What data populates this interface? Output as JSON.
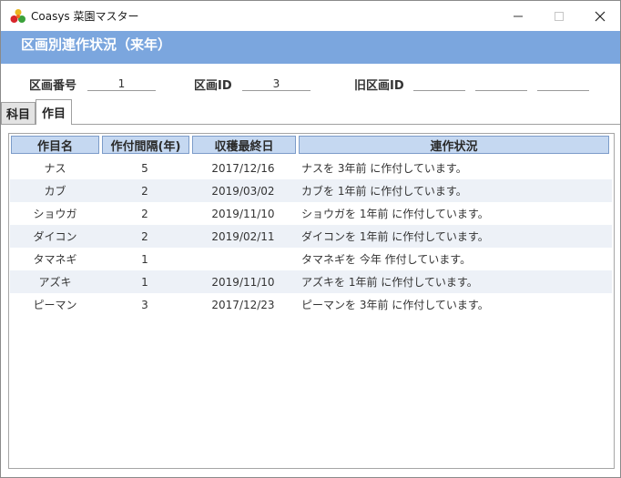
{
  "window": {
    "title": "Coasys 菜園マスター"
  },
  "header": {
    "title": "区画別連作状況（来年）"
  },
  "fields": {
    "section_no_label": "区画番号",
    "section_no_value": "1",
    "section_id_label": "区画ID",
    "section_id_value": "3",
    "old_section_id_label": "旧区画ID",
    "old_section_id_values": [
      "",
      "",
      ""
    ]
  },
  "tabs": [
    {
      "label": "科目",
      "active": false
    },
    {
      "label": "作目",
      "active": true
    }
  ],
  "table": {
    "columns": [
      "作目名",
      "作付間隔(年)",
      "収穫最終日",
      "連作状況"
    ],
    "rows": [
      {
        "name": "ナス",
        "interval": "5",
        "last_harvest": "2017/12/16",
        "status": "ナスを 3年前 に作付しています。"
      },
      {
        "name": "カブ",
        "interval": "2",
        "last_harvest": "2019/03/02",
        "status": "カブを 1年前 に作付しています。"
      },
      {
        "name": "ショウガ",
        "interval": "2",
        "last_harvest": "2019/11/10",
        "status": "ショウガを 1年前 に作付しています。"
      },
      {
        "name": "ダイコン",
        "interval": "2",
        "last_harvest": "2019/02/11",
        "status": "ダイコンを 1年前 に作付しています。"
      },
      {
        "name": "タマネギ",
        "interval": "1",
        "last_harvest": "",
        "status": "タマネギを 今年 作付しています。"
      },
      {
        "name": "アズキ",
        "interval": "1",
        "last_harvest": "2019/11/10",
        "status": "アズキを 1年前 に作付しています。"
      },
      {
        "name": "ピーマン",
        "interval": "3",
        "last_harvest": "2017/12/23",
        "status": "ピーマンを 3年前 に作付しています。"
      }
    ]
  },
  "colors": {
    "header_band": "#7ba6de",
    "column_header": "#c5d8f1",
    "alt_row": "#edf1f7"
  },
  "icons": {
    "app": "vegetable-logo-icon",
    "minimize": "minimize-icon",
    "maximize": "maximize-icon",
    "close": "close-icon"
  }
}
